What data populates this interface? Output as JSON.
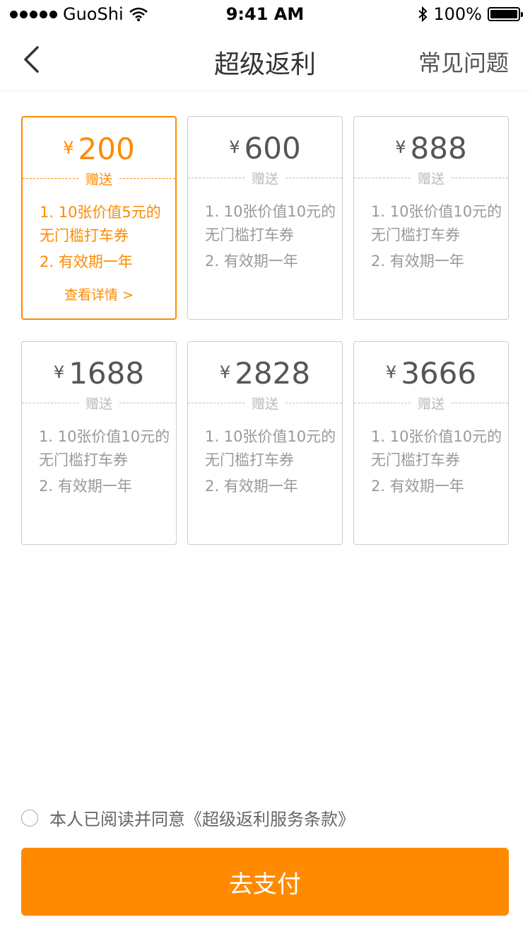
{
  "status_bar": {
    "carrier": "GuoShi",
    "time": "9:41 AM",
    "battery": "100%",
    "icons": [
      "signal-dots-icon",
      "wifi-icon",
      "bluetooth-icon",
      "battery-icon"
    ]
  },
  "nav": {
    "title": "超级返利",
    "right_link": "常见问题",
    "back_icon": "chevron-left-icon"
  },
  "colors": {
    "accent": "#ff8a00",
    "border": "#cccccc",
    "muted_text": "#999999"
  },
  "currency_symbol": "¥",
  "gift_label": "赠送",
  "cards": [
    {
      "amount": "200",
      "benefit_1": "1. 10张价值5元的无门槛打车券",
      "benefit_2": "2. 有效期一年",
      "selected": true,
      "details_link": "查看详情 >"
    },
    {
      "amount": "600",
      "benefit_1": "1. 10张价值10元的无门槛打车券",
      "benefit_2": "2. 有效期一年",
      "selected": false
    },
    {
      "amount": "888",
      "benefit_1": "1. 10张价值10元的无门槛打车券",
      "benefit_2": "2. 有效期一年",
      "selected": false
    },
    {
      "amount": "1688",
      "benefit_1": "1. 10张价值10元的无门槛打车券",
      "benefit_2": "2. 有效期一年",
      "selected": false
    },
    {
      "amount": "2828",
      "benefit_1": "1. 10张价值10元的无门槛打车券",
      "benefit_2": "2. 有效期一年",
      "selected": false
    },
    {
      "amount": "3666",
      "benefit_1": "1. 10张价值10元的无门槛打车券",
      "benefit_2": "2. 有效期一年",
      "selected": false
    }
  ],
  "agreement": {
    "text": "本人已阅读并同意《超级返利服务条款》",
    "checked": false
  },
  "pay_button": {
    "label": "去支付"
  }
}
